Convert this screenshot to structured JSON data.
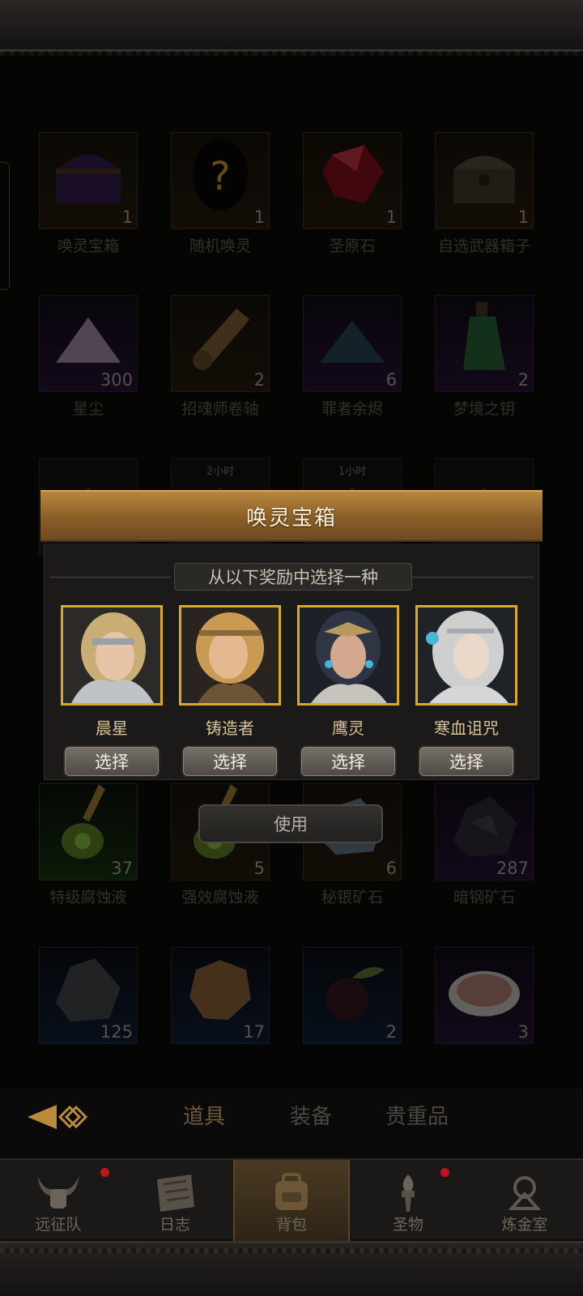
{
  "items": [
    {
      "name": "唤灵宝箱",
      "count": "1",
      "rarity": "orange",
      "icon": "purple-chest-icon"
    },
    {
      "name": "随机唤灵",
      "count": "1",
      "rarity": "orange",
      "icon": "mystery-hero-icon"
    },
    {
      "name": "圣原石",
      "count": "1",
      "rarity": "orange",
      "icon": "red-crystal-icon"
    },
    {
      "name": "自选武器箱子",
      "count": "1",
      "rarity": "orange",
      "icon": "treasure-chest-icon"
    },
    {
      "name": "星尘",
      "count": "300",
      "rarity": "purple",
      "icon": "stardust-icon"
    },
    {
      "name": "招魂师卷轴",
      "count": "2",
      "rarity": "orange",
      "icon": "scroll-icon"
    },
    {
      "name": "罪者余烬",
      "count": "6",
      "rarity": "purple",
      "icon": "ash-pile-icon"
    },
    {
      "name": "梦境之钥",
      "count": "2",
      "rarity": "purple",
      "icon": "green-bottle-icon"
    },
    {
      "name": "",
      "count": "",
      "rarity": "gray",
      "icon": "item-icon",
      "timer": ""
    },
    {
      "name": "",
      "count": "",
      "rarity": "gray",
      "icon": "item-icon",
      "timer": "2小时"
    },
    {
      "name": "",
      "count": "",
      "rarity": "gray",
      "icon": "item-icon",
      "timer": "1小时"
    },
    {
      "name": "",
      "count": "",
      "rarity": "gray",
      "icon": "item-icon",
      "timer": ""
    },
    {
      "name": "特级腐蚀液",
      "count": "37",
      "rarity": "green",
      "icon": "potion-flask-icon"
    },
    {
      "name": "强效腐蚀液",
      "count": "5",
      "rarity": "orange",
      "icon": "potion-flask-icon"
    },
    {
      "name": "秘银矿石",
      "count": "6",
      "rarity": "orange",
      "icon": "mithril-ore-icon"
    },
    {
      "name": "暗钢矿石",
      "count": "287",
      "rarity": "purple",
      "icon": "dark-ore-icon"
    },
    {
      "name": "",
      "count": "125",
      "rarity": "blue",
      "icon": "stone-ore-icon"
    },
    {
      "name": "",
      "count": "17",
      "rarity": "blue",
      "icon": "hide-leather-icon"
    },
    {
      "name": "",
      "count": "2",
      "rarity": "blue",
      "icon": "fruit-icon"
    },
    {
      "name": "",
      "count": "3",
      "rarity": "purple",
      "icon": "meat-icon"
    }
  ],
  "modal": {
    "title": "唤灵宝箱",
    "subtitle": "从以下奖励中选择一种",
    "select_label": "选择",
    "choices": [
      {
        "name": "晨星",
        "icon": "blonde-warrior-portrait"
      },
      {
        "name": "铸造者",
        "icon": "braided-smith-portrait"
      },
      {
        "name": "鹰灵",
        "icon": "dark-haired-huntress-portrait"
      },
      {
        "name": "寒血诅咒",
        "icon": "white-haired-sorceress-portrait"
      }
    ]
  },
  "use_button": "使用",
  "tabs": [
    {
      "label": "道具",
      "active": true
    },
    {
      "label": "装备",
      "active": false
    },
    {
      "label": "贵重品",
      "active": false
    }
  ],
  "nav": [
    {
      "label": "远征队",
      "icon": "horned-helmet-icon",
      "badge": true,
      "active": false
    },
    {
      "label": "日志",
      "icon": "map-scroll-icon",
      "badge": false,
      "active": false
    },
    {
      "label": "背包",
      "icon": "backpack-icon",
      "badge": false,
      "active": true
    },
    {
      "label": "圣物",
      "icon": "torch-relic-icon",
      "badge": true,
      "active": false
    },
    {
      "label": "炼金室",
      "icon": "alchemy-icon",
      "badge": false,
      "active": false
    }
  ],
  "colors": {
    "accent_gold": "#d9a92a",
    "header_brown": "#8a5e28",
    "badge_red": "#c3141a"
  }
}
